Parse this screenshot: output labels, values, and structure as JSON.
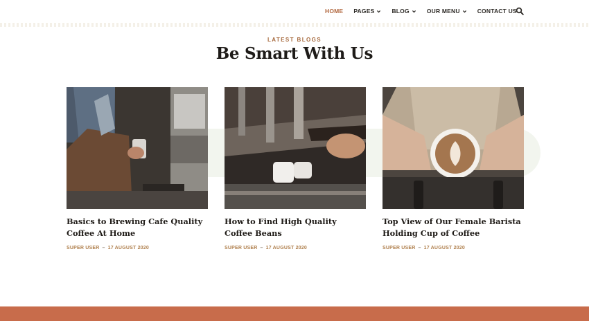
{
  "nav": {
    "items": [
      {
        "label": "HOME",
        "active": true,
        "dropdown": false
      },
      {
        "label": "PAGES",
        "active": false,
        "dropdown": true
      },
      {
        "label": "BLOG",
        "active": false,
        "dropdown": true
      },
      {
        "label": "OUR MENU",
        "active": false,
        "dropdown": true
      },
      {
        "label": "CONTACT US",
        "active": false,
        "dropdown": false
      }
    ],
    "search_icon": "search-icon"
  },
  "section": {
    "eyebrow": "LATEST BLOGS",
    "title": "Be Smart With Us"
  },
  "posts": [
    {
      "title": "Basics to Brewing Cafe Quality Coffee At Home",
      "author": "SUPER USER",
      "date": "17 AUGUST 2020",
      "image": "barista-steaming-milk"
    },
    {
      "title": "How to Find High Quality Coffee Beans",
      "author": "SUPER USER",
      "date": "17 AUGUST 2020",
      "image": "espresso-machine-pour"
    },
    {
      "title": "Top View of Our Female Barista Holding Cup of Coffee",
      "author": "SUPER USER",
      "date": "17 AUGUST 2020",
      "image": "latte-art-cup"
    }
  ],
  "colors": {
    "accent": "#b1673e",
    "meta": "#b0804e",
    "footer": "#c86c4b"
  }
}
